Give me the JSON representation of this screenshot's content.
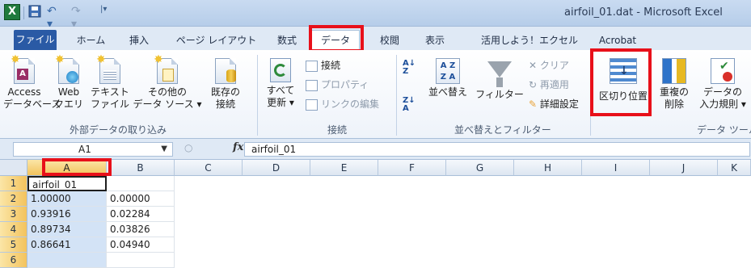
{
  "window": {
    "title": "airfoil_01.dat - Microsoft Excel"
  },
  "qat": {
    "app_icon": "X"
  },
  "tabs": [
    {
      "label": "ファイル"
    },
    {
      "label": "ホーム"
    },
    {
      "label": "挿入"
    },
    {
      "label": "ページ レイアウト"
    },
    {
      "label": "数式"
    },
    {
      "label": "データ"
    },
    {
      "label": "校閲"
    },
    {
      "label": "表示"
    },
    {
      "label": "活用しよう！エクセル"
    },
    {
      "label": "Acrobat"
    }
  ],
  "ribbon": {
    "external": {
      "access": "Access\nデータベース",
      "access_l1": "Access",
      "access_l2": "データベース",
      "web_l1": "Web",
      "web_l2": "クエリ",
      "text_l1": "テキスト",
      "text_l2": "ファイル",
      "other_l1": "その他の",
      "other_l2": "データ ソース ▾",
      "existing_l1": "既存の",
      "existing_l2": "接続",
      "group": "外部データの取り込み"
    },
    "connections": {
      "refresh_l1": "すべて",
      "refresh_l2": "更新 ▾",
      "conn": "接続",
      "props": "プロパティ",
      "edit_links": "リンクの編集",
      "group": "接続"
    },
    "sort": {
      "sort_label": "並べ替え",
      "filter_label": "フィルター",
      "clear": "クリア",
      "reapply": "再適用",
      "advanced": "詳細設定",
      "group": "並べ替えとフィルター"
    },
    "tools": {
      "ttc": "区切り位置",
      "dup_l1": "重複の",
      "dup_l2": "削除",
      "valid_l1": "データの",
      "valid_l2": "入力規則 ▾",
      "group": "データ ツール"
    }
  },
  "formula_bar": {
    "name_box": "A1",
    "fx": "fx",
    "formula": "airfoil_01"
  },
  "columns": [
    "A",
    "B",
    "C",
    "D",
    "E",
    "F",
    "G",
    "H",
    "I",
    "J",
    "K"
  ],
  "rows": [
    {
      "num": "1",
      "a": "airfoil_01",
      "b": ""
    },
    {
      "num": "2",
      "a": "1.00000",
      "b": "0.00000"
    },
    {
      "num": "3",
      "a": "0.93916",
      "b": "0.02284"
    },
    {
      "num": "4",
      "a": "0.89734",
      "b": "0.03826"
    },
    {
      "num": "5",
      "a": "0.86641",
      "b": "0.04940"
    },
    {
      "num": "6",
      "a": "",
      "b": ""
    }
  ]
}
